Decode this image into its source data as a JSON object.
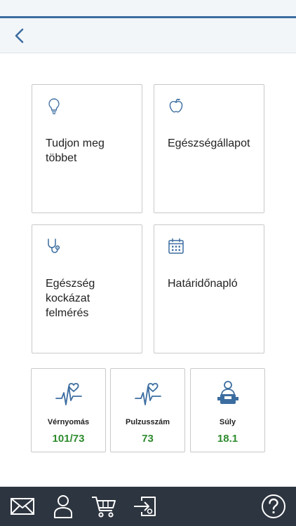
{
  "colors": {
    "accent": "#3c6da0",
    "value_green": "#2e8b2e",
    "bottom_bar": "#2d3540"
  },
  "header": {
    "back_icon": "chevron-left-icon"
  },
  "tiles": [
    {
      "label": "Tudjon meg\ntöbbet",
      "icon": "lightbulb-icon"
    },
    {
      "label": "Egészségállapot",
      "icon": "apple-icon"
    },
    {
      "label": "Egészség\nkockázat\nfelmérés",
      "icon": "stethoscope-icon"
    },
    {
      "label": "Határidőnapló",
      "icon": "calendar-icon"
    }
  ],
  "metrics": [
    {
      "label": "Vérnyomás",
      "value": "101/73",
      "icon": "heart-pulse-icon"
    },
    {
      "label": "Pulzusszám",
      "value": "73",
      "icon": "heart-pulse-icon"
    },
    {
      "label": "Súly",
      "value": "18.1",
      "icon": "person-scale-icon"
    }
  ],
  "bottom_nav": [
    {
      "icon": "mail-icon"
    },
    {
      "icon": "profile-icon"
    },
    {
      "icon": "cart-icon"
    },
    {
      "icon": "logout-icon"
    },
    {
      "icon": "help-icon"
    }
  ]
}
